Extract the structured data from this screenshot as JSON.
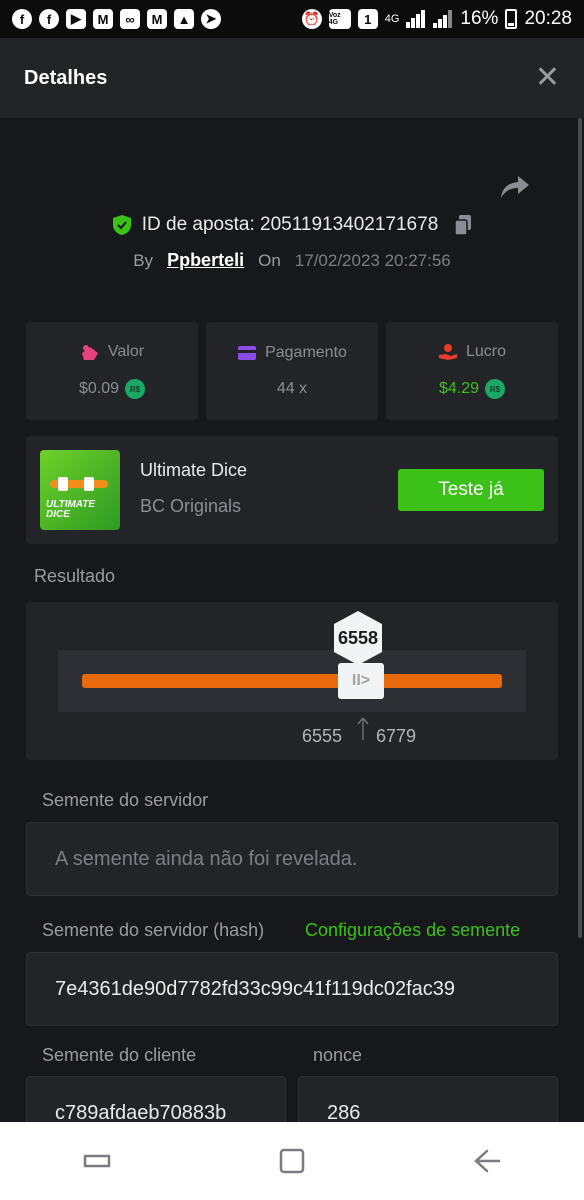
{
  "status_bar": {
    "left_icons": [
      "facebook-icon",
      "facebook-icon",
      "youtube-icon",
      "mail-icon",
      "voicemail-icon",
      "mail-icon",
      "gallery-icon",
      "telegram-icon"
    ],
    "volte": "Voz 4G",
    "sim": "1",
    "network": "4G",
    "battery": "16%",
    "time": "20:28"
  },
  "header": {
    "title": "Detalhes",
    "close": "✕"
  },
  "bet": {
    "id_label": "ID de aposta: 20511913402171678",
    "by_label": "By",
    "user": "Ppberteli",
    "on_label": "On",
    "date": "17/02/2023 20:27:56"
  },
  "cards": [
    {
      "label": "Valor",
      "value": "$0.09",
      "badge": "R$",
      "icon": "bet-amount-icon",
      "color": "#e8427c"
    },
    {
      "label": "Pagamento",
      "value": "44 x",
      "badge": "",
      "icon": "wallet-icon",
      "color": "#8a4ce8"
    },
    {
      "label": "Lucro",
      "value": "$4.29",
      "badge": "R$",
      "icon": "profit-hand-icon",
      "color": "#e83b2e"
    }
  ],
  "game": {
    "thumb_title": "ULTIMATE DICE",
    "name": "Ultimate Dice",
    "provider": "BC Originals",
    "try_button": "Teste já"
  },
  "result": {
    "label": "Resultado",
    "value": "6558",
    "range_low": "6555",
    "range_high": "6779",
    "handle_glyph": "II>"
  },
  "seeds": {
    "server_label": "Semente do servidor",
    "server_value": "A semente ainda não foi revelada.",
    "server_hash_label": "Semente do servidor (hash)",
    "settings_link": "Configurações de semente",
    "server_hash": "7e4361de90d7782fd33c99c41f119dc02fac39",
    "client_label": "Semente do cliente",
    "client_value": "c789afdaeb70883b",
    "nonce_label": "nonce",
    "nonce_value": "286"
  },
  "colors": {
    "accent_green": "#3bc117",
    "track_orange": "#e86a0c",
    "panel": "#232428",
    "background": "#17181b"
  }
}
